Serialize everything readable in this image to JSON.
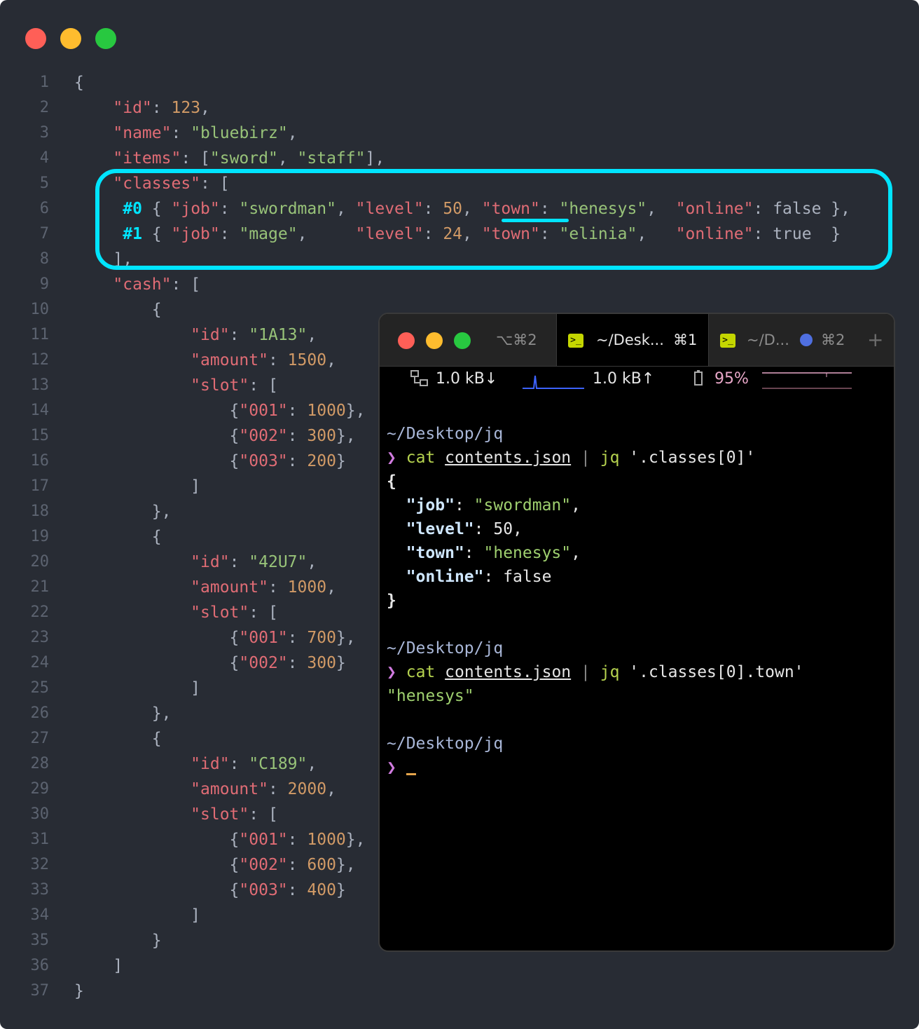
{
  "editor": {
    "line_numbers": [
      "1",
      "2",
      "3",
      "4",
      "5",
      "6",
      "7",
      "8",
      "9",
      "10",
      "11",
      "12",
      "13",
      "14",
      "15",
      "16",
      "17",
      "18",
      "19",
      "20",
      "21",
      "22",
      "23",
      "24",
      "25",
      "26",
      "27",
      "28",
      "29",
      "30",
      "31",
      "32",
      "33",
      "34",
      "35",
      "36",
      "37"
    ],
    "lines": [
      "{",
      "    \"id\": 123,",
      "    \"name\": \"bluebirz\",",
      "    \"items\": [\"sword\", \"staff\"],",
      "    \"classes\": [",
      "     #0 { \"job\": \"swordman\", \"level\": 50, \"town\": \"henesys\",  \"online\": false },",
      "     #1 { \"job\": \"mage\",     \"level\": 24, \"town\": \"elinia\",   \"online\": true  }",
      "    ],",
      "    \"cash\": [",
      "        {",
      "            \"id\": \"1A13\",",
      "            \"amount\": 1500,",
      "            \"slot\": [",
      "                {\"001\": 1000},",
      "                {\"002\": 300},",
      "                {\"003\": 200}",
      "            ]",
      "        },",
      "        {",
      "            \"id\": \"42U7\",",
      "            \"amount\": 1000,",
      "            \"slot\": [",
      "                {\"001\": 700},",
      "                {\"002\": 300}",
      "            ]",
      "        },",
      "        {",
      "            \"id\": \"C189\",",
      "            \"amount\": 2000,",
      "            \"slot\": [",
      "                {\"001\": 1000},",
      "                {\"002\": 600},",
      "                {\"003\": 400}",
      "            ]",
      "        }",
      "    ]",
      "}"
    ]
  },
  "terminal": {
    "tabs": [
      {
        "label": "⌥⌘2"
      },
      {
        "label": "~/Desk...",
        "shortcut": "⌘1",
        "active": true
      },
      {
        "label": "~/D...",
        "shortcut": "⌘2"
      }
    ],
    "new_tab": "+",
    "status": {
      "down": "1.0 kB↓",
      "up": "1.0 kB↑",
      "battery": "95%"
    },
    "lines": [
      {
        "type": "path",
        "text": "~/Desktop/jq"
      },
      {
        "type": "cmd",
        "prompt": "❯",
        "cmd": "cat",
        "arg": "contents.json",
        "pipe": "|",
        "tool": "jq",
        "query": "'.classes[0]'"
      },
      {
        "type": "out",
        "text": "{"
      },
      {
        "type": "kv",
        "key": "\"job\"",
        "sep": ": ",
        "val": "\"swordman\"",
        "vtype": "s",
        "tail": ","
      },
      {
        "type": "kv",
        "key": "\"level\"",
        "sep": ": ",
        "val": "50",
        "vtype": "n",
        "tail": ","
      },
      {
        "type": "kv",
        "key": "\"town\"",
        "sep": ": ",
        "val": "\"henesys\"",
        "vtype": "s",
        "tail": ","
      },
      {
        "type": "kv",
        "key": "\"online\"",
        "sep": ": ",
        "val": "false",
        "vtype": "n",
        "tail": ""
      },
      {
        "type": "out",
        "text": "}"
      },
      {
        "type": "blank",
        "text": ""
      },
      {
        "type": "path",
        "text": "~/Desktop/jq"
      },
      {
        "type": "cmd",
        "prompt": "❯",
        "cmd": "cat",
        "arg": "contents.json",
        "pipe": "|",
        "tool": "jq",
        "query": "'.classes[0].town'"
      },
      {
        "type": "str",
        "text": "\"henesys\""
      },
      {
        "type": "blank",
        "text": ""
      },
      {
        "type": "path",
        "text": "~/Desktop/jq"
      },
      {
        "type": "prompt",
        "prompt": "❯"
      }
    ]
  },
  "colors": {
    "highlight": "#00e5ff",
    "editor_bg": "#282c34",
    "terminal_bg": "#000000"
  }
}
